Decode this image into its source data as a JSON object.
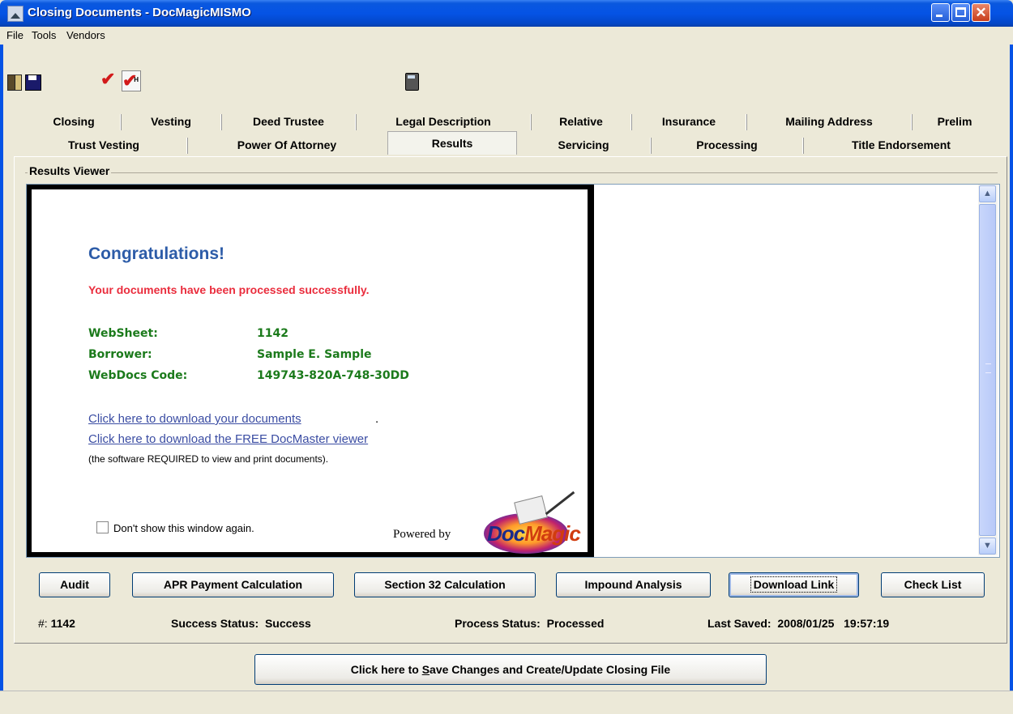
{
  "window": {
    "title": "Closing Documents - DocMagicMISMO"
  },
  "menu": [
    "File",
    "Tools",
    "Vendors"
  ],
  "toolbar": {
    "exit_icon": "exit-door-icon",
    "save_icon": "floppy-disk-icon",
    "check_icon": "checkmark-icon",
    "check_h_icon": "checkmark-h-icon",
    "check_h_letter": "H",
    "calc_icon": "calculator-icon"
  },
  "tabs_row1": [
    "Closing",
    "Vesting",
    "Deed Trustee",
    "Legal Description",
    "Relative",
    "Insurance",
    "Mailing Address",
    "Prelim"
  ],
  "tabs_row2": [
    "Trust Vesting",
    "Power Of Attorney",
    "Results",
    "Servicing",
    "Processing",
    "Title Endorsement"
  ],
  "active_tab": "Results",
  "results": {
    "group_label": "Results Viewer",
    "heading": "Congratulations!",
    "message": "Your documents have been processed successfully.",
    "fields": [
      {
        "label": "WebSheet:",
        "value": "1142"
      },
      {
        "label": "Borrower:",
        "value": "Sample E. Sample"
      },
      {
        "label": "WebDocs Code:",
        "value": "149743-820A-748-30DD"
      }
    ],
    "link_download": "Click here to download your documents",
    "link_viewer": "Click here to download the FREE DocMaster viewer",
    "period": ".",
    "note": "(the software REQUIRED to view and print documents).",
    "dont_show": "Don't show this window again.",
    "powered_by": "Powered by",
    "logo_text_a": "Doc",
    "logo_text_b": "Magic"
  },
  "buttons": [
    "Audit",
    "APR Payment Calculation",
    "Section 32 Calculation",
    "Impound Analysis",
    "Download Link",
    "Check List"
  ],
  "status": {
    "hash_label": "#:",
    "hash_value": "1142",
    "success_label": "Success Status:",
    "success_value": "Success",
    "process_label": "Process Status:",
    "process_value": "Processed",
    "saved_label": "Last Saved:",
    "saved_date": "2008/01/25",
    "saved_time": "19:57:19"
  },
  "save_button": {
    "pre": "Click here to ",
    "mnemonic": "S",
    "post": "ave Changes and Create/Update Closing File"
  },
  "colors": {
    "title_bar": "#0553e5",
    "heading": "#2d5ca8",
    "message": "#ea2d3d",
    "fields": "#1b7a1b",
    "link": "#3b4da3"
  }
}
